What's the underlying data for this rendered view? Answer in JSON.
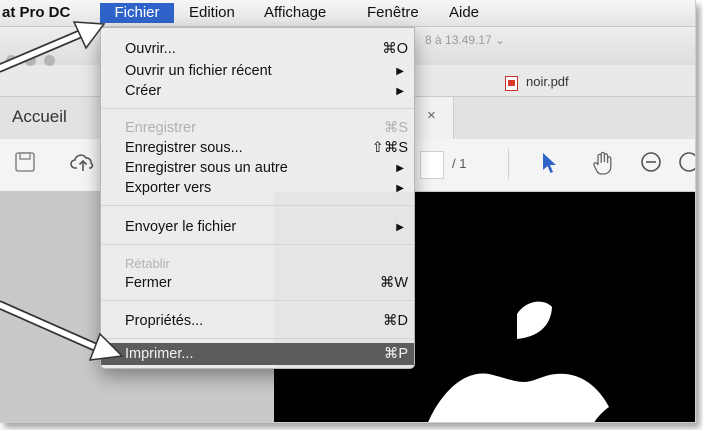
{
  "menubar": {
    "app_label": "at Pro DC",
    "items": [
      "Fichier",
      "Edition",
      "Affichage",
      "Fenêtre",
      "Aide"
    ]
  },
  "window": {
    "title_fragment": "8 à 13.49.17 ⌄",
    "document_tab_title": "noir.pdf"
  },
  "tabs": {
    "home_label": "Accueil",
    "close_glyph": "×"
  },
  "toolbar": {
    "page_total": "/ 1"
  },
  "file_menu": {
    "items": [
      {
        "label": "Ouvrir...",
        "shortcut": "⌘O"
      },
      {
        "label": "Ouvrir un fichier récent",
        "submenu": "▶"
      },
      {
        "label": "Créer",
        "submenu": "▶"
      },
      {
        "label": "Enregistrer",
        "shortcut": "⌘S"
      },
      {
        "label": "Enregistrer sous...",
        "shortcut": "⇧⌘S"
      },
      {
        "label": "Enregistrer sous un autre",
        "submenu": "▶"
      },
      {
        "label": "Exporter vers",
        "submenu": "▶"
      },
      {
        "label": "Envoyer le fichier",
        "submenu": "▶"
      },
      {
        "label": "Rétablir"
      },
      {
        "label": "Fermer",
        "shortcut": "⌘W"
      },
      {
        "label": "Propriétés...",
        "shortcut": "⌘D"
      },
      {
        "label": "Imprimer...",
        "shortcut": "⌘P"
      }
    ],
    "disabled": [
      "Enregistrer",
      "Rétablir"
    ],
    "highlighted": "Imprimer..."
  },
  "colors": {
    "menu_highlight": "#2f63c9",
    "selected_item": "#5c5c5c",
    "pdf_icon": "#d9382f",
    "cursor_tool": "#2f63c9",
    "annotation_arrow": "#ffffff"
  },
  "icons": [
    "save-icon",
    "upload-icon",
    "cursor-icon",
    "hand-icon",
    "zoom-out-icon",
    "zoom-in-icon",
    "pdf-file-icon",
    "apple-logo"
  ]
}
